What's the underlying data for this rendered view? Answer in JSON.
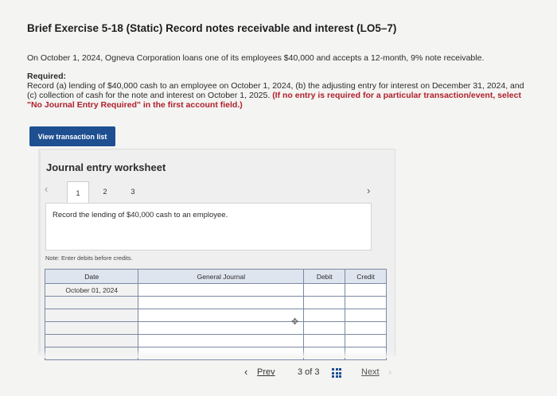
{
  "header": {
    "title": "Brief Exercise 5-18 (Static) Record notes receivable and interest (LO5–7)"
  },
  "problem": {
    "intro": "On October 1, 2024, Ogneva Corporation loans one of its employees $40,000 and accepts a 12-month, 9% note receivable.",
    "required_label": "Required:",
    "required_line1": "Record (a) lending of $40,000 cash to an employee on October 1, 2024, (b) the adjusting entry for interest on December 31, 2024, and",
    "required_line2_plain": "(c) collection of cash for the note and interest on October 1, 2025. ",
    "required_line2_red": "(If no entry is required for a particular transaction/event, select",
    "required_line3_red": "\"No Journal Entry Required\" in the first account field.)"
  },
  "buttons": {
    "view_transactions": "View transaction list"
  },
  "worksheet": {
    "title": "Journal entry worksheet",
    "tabs": [
      "1",
      "2",
      "3"
    ],
    "active_tab": "1",
    "instruction": "Record the lending of $40,000 cash to an employee.",
    "note": "Note: Enter debits before credits.",
    "columns": {
      "date": "Date",
      "account": "General Journal",
      "debit": "Debit",
      "credit": "Credit"
    },
    "rows": [
      {
        "date": "October 01, 2024"
      },
      {
        "date": ""
      },
      {
        "date": ""
      },
      {
        "date": ""
      },
      {
        "date": ""
      },
      {
        "date": ""
      }
    ]
  },
  "pagination": {
    "prev_label": "Prev",
    "position": "3 of 3",
    "next_label": "Next"
  },
  "colors": {
    "accent": "#1d4f91",
    "required_note": "#b0202a",
    "table_header": "#dfe5ef"
  }
}
